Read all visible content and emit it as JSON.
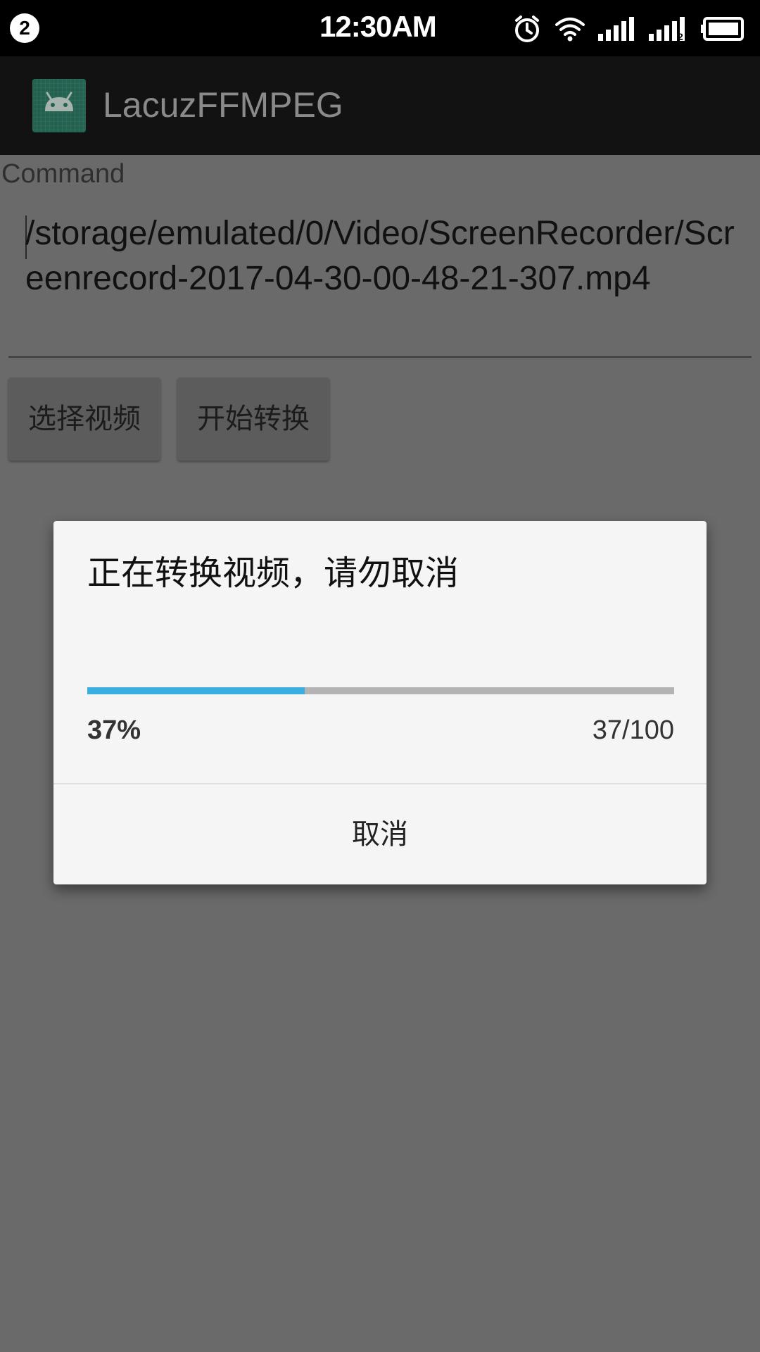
{
  "status_bar": {
    "notification_count": "2",
    "time": "12:30AM",
    "icons": [
      "alarm-icon",
      "wifi-icon",
      "signal-sim1-icon",
      "signal-sim2-icon",
      "battery-icon"
    ],
    "sim2_label": "2"
  },
  "app_bar": {
    "title": "LacuzFFMPEG",
    "icon": "android-icon"
  },
  "form": {
    "command_label": "Command",
    "command_value": "/storage/emulated/0/Video/ScreenRecorder/Screenrecord-2017-04-30-00-48-21-307.mp4"
  },
  "buttons": {
    "select_video": "选择视频",
    "start_convert": "开始转换"
  },
  "dialog": {
    "title": "正在转换视频，请勿取消",
    "progress_fraction": 0.37,
    "percent_label": "37%",
    "count_label": "37/100",
    "cancel_label": "取消"
  },
  "colors": {
    "progress_accent": "#3aaee0",
    "scrim": "#6a6a6a",
    "dialog_bg": "#f5f5f5"
  }
}
